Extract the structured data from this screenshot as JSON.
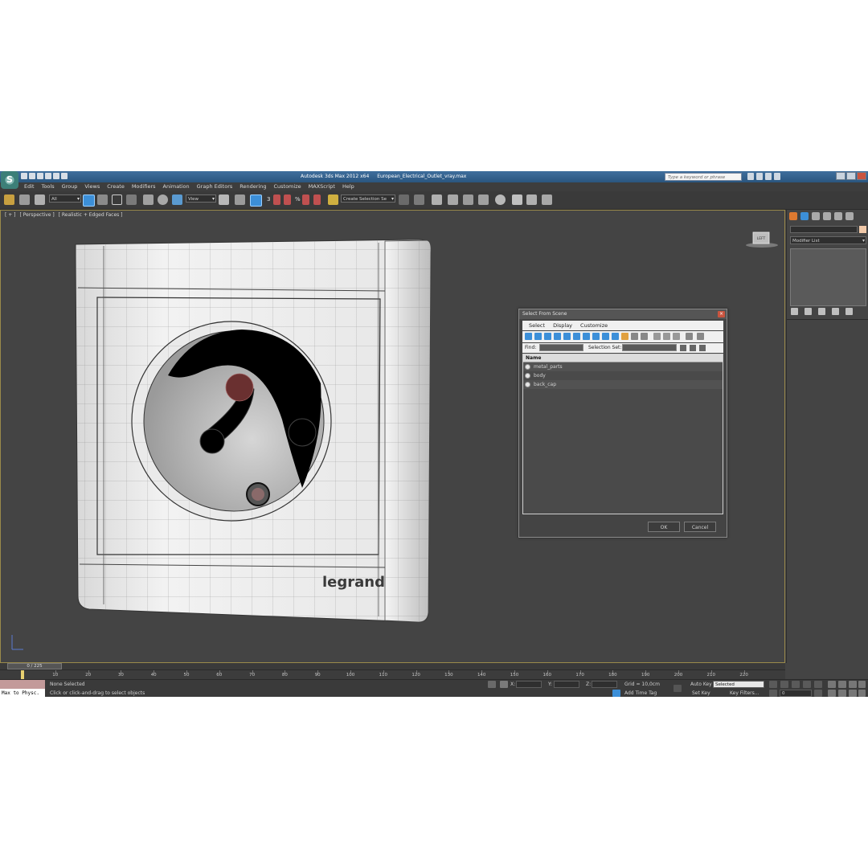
{
  "app": {
    "title": "Autodesk 3ds Max  2012 x64",
    "file": "European_Electrical_Outlet_vray.max",
    "logo": "S",
    "search_placeholder": "Type a keyword or phrase"
  },
  "menu": [
    "Edit",
    "Tools",
    "Group",
    "Views",
    "Create",
    "Modifiers",
    "Animation",
    "Graph Editors",
    "Rendering",
    "Customize",
    "MAXScript",
    "Help"
  ],
  "toolbar": {
    "selection_filter": "All",
    "ref_coord": "View",
    "named_selection": "Create Selection Se",
    "snap_labels": [
      "3",
      "%"
    ]
  },
  "viewport": {
    "labels": [
      "[ + ]",
      "[ Perspective ]",
      "[ Realistic + Edged Faces ]"
    ],
    "brand_text": "legrand",
    "viewcube_label": "LEFT"
  },
  "dialog": {
    "title": "Select From Scene",
    "tabs": [
      "Select",
      "Display",
      "Customize"
    ],
    "find_label": "Find:",
    "selection_set_label": "Selection Set:",
    "column_header": "Name",
    "objects": [
      "metal_parts",
      "body",
      "back_cap"
    ],
    "ok_label": "OK",
    "cancel_label": "Cancel"
  },
  "command_panel": {
    "modifier_list": "Modifier List"
  },
  "timeline": {
    "frame_display": "0 / 225",
    "ticks": [
      0,
      10,
      20,
      30,
      40,
      50,
      60,
      70,
      80,
      90,
      100,
      110,
      120,
      130,
      140,
      150,
      160,
      170,
      180,
      190,
      200,
      210,
      220
    ]
  },
  "status": {
    "max_to_physc": "Max to Physc.",
    "selection_status": "None Selected",
    "prompt": "Click or click-and-drag to select objects",
    "x_label": "X:",
    "y_label": "Y:",
    "z_label": "Z:",
    "grid": "Grid = 10,0cm",
    "add_time_tag": "Add Time Tag",
    "auto_key": "Auto Key",
    "set_key": "Set Key",
    "key_mode": "Selected",
    "key_filters": "Key Filters...",
    "current_frame": "0"
  },
  "colors": {
    "viewport_bg": "#444444",
    "active_border": "#9a8a4a",
    "title_bar": "#2a557f",
    "accent_blue": "#3c8fd8"
  }
}
